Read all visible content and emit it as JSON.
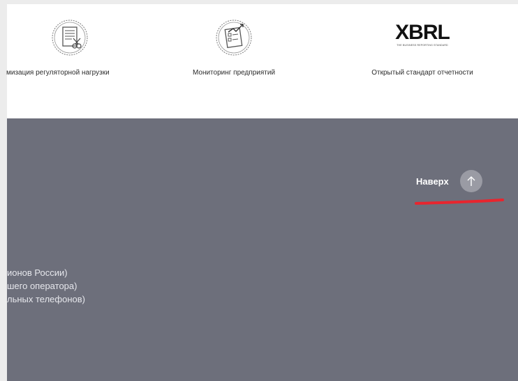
{
  "services": [
    {
      "label": "мизация регуляторной нагрузки",
      "icon": "document-scissors-seal-icon"
    },
    {
      "label": "Мониторинг предприятий",
      "icon": "checklist-chart-seal-icon"
    },
    {
      "label": "Открытый стандарт отчетности",
      "icon": "xbrl-logo",
      "logo_text": "XBRL",
      "logo_tagline": "THE BUSINESS REPORTING STANDARD"
    }
  ],
  "footer": {
    "to_top_label": "Наверх",
    "phone_lines": [
      "ионов России)",
      "шего оператора)",
      "льных телефонов)"
    ]
  },
  "colors": {
    "footer_bg": "#6d6f7b",
    "to_top_button": "#9a9ba4",
    "annotation_red": "#e8252e"
  }
}
